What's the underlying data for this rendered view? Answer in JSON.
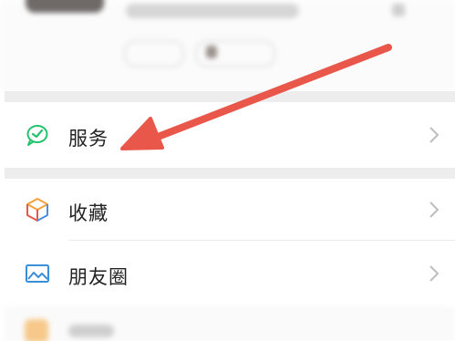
{
  "menu": {
    "items": [
      {
        "label": "服务",
        "icon": "service-check-icon"
      },
      {
        "label": "收藏",
        "icon": "favorites-cube-icon"
      },
      {
        "label": "朋友圈",
        "icon": "moments-photo-icon"
      }
    ]
  },
  "annotation": {
    "arrow_color": "#e8574a",
    "arrow_target": "服务"
  },
  "colors": {
    "service_icon": "#25c26e",
    "favorites_icon_orange": "#f4a13d",
    "favorites_icon_blue": "#4a90e2",
    "moments_icon": "#3b8fd9",
    "chevron": "#bdbdbd",
    "section_gap": "#ededed"
  }
}
